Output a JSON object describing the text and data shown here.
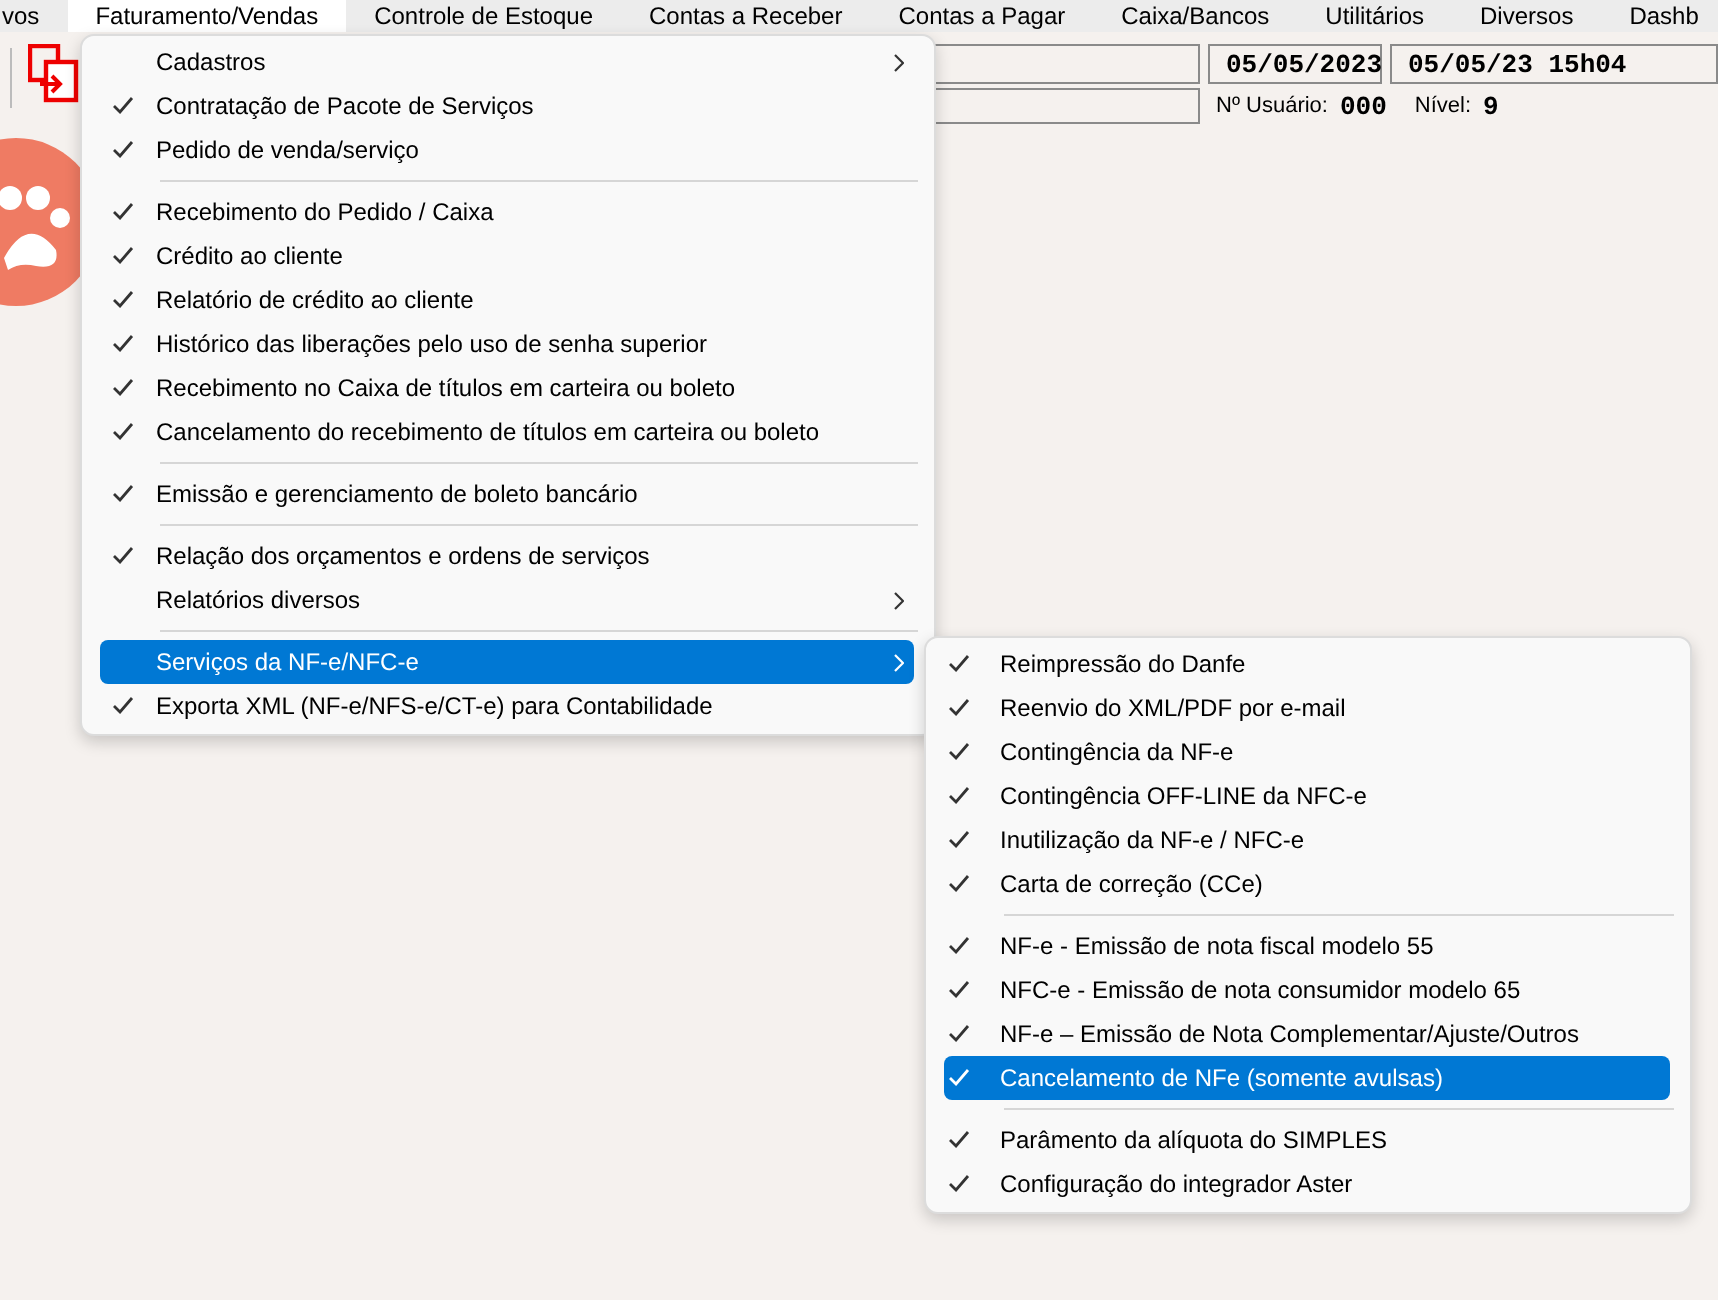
{
  "menubar": [
    {
      "label": "vos",
      "selected": false
    },
    {
      "label": "Faturamento/Vendas",
      "selected": true
    },
    {
      "label": "Controle de Estoque",
      "selected": false
    },
    {
      "label": "Contas a Receber",
      "selected": false
    },
    {
      "label": "Contas a Pagar",
      "selected": false
    },
    {
      "label": "Caixa/Bancos",
      "selected": false
    },
    {
      "label": "Utilitários",
      "selected": false
    },
    {
      "label": "Diversos",
      "selected": false
    },
    {
      "label": "Dashb",
      "selected": false
    }
  ],
  "status": {
    "date": "05/05/2023",
    "datetime": "05/05/23 15h04",
    "user_label": "Nº Usuário:",
    "user": "000",
    "level_label": "Nível:",
    "level_value": "9"
  },
  "menu": [
    {
      "kind": "item",
      "label": "Cadastros",
      "checked": false,
      "submenu": true,
      "selected": false
    },
    {
      "kind": "item",
      "label": "Contratação de Pacote de Serviços",
      "checked": true,
      "submenu": false,
      "selected": false
    },
    {
      "kind": "item",
      "label": "Pedido de venda/serviço",
      "checked": true,
      "submenu": false,
      "selected": false
    },
    {
      "kind": "separator"
    },
    {
      "kind": "item",
      "label": "Recebimento do Pedido / Caixa",
      "checked": true,
      "submenu": false,
      "selected": false
    },
    {
      "kind": "item",
      "label": "Crédito ao cliente",
      "checked": true,
      "submenu": false,
      "selected": false
    },
    {
      "kind": "item",
      "label": "Relatório de crédito ao cliente",
      "checked": true,
      "submenu": false,
      "selected": false
    },
    {
      "kind": "item",
      "label": "Histórico das liberações pelo uso de senha superior",
      "checked": true,
      "submenu": false,
      "selected": false
    },
    {
      "kind": "item",
      "label": "Recebimento no Caixa de títulos em carteira ou boleto",
      "checked": true,
      "submenu": false,
      "selected": false
    },
    {
      "kind": "item",
      "label": "Cancelamento do recebimento de títulos em carteira ou boleto",
      "checked": true,
      "submenu": false,
      "selected": false
    },
    {
      "kind": "separator"
    },
    {
      "kind": "item",
      "label": "Emissão e gerenciamento de boleto bancário",
      "checked": true,
      "submenu": false,
      "selected": false
    },
    {
      "kind": "separator"
    },
    {
      "kind": "item",
      "label": "Relação dos orçamentos e ordens de serviços",
      "checked": true,
      "submenu": false,
      "selected": false
    },
    {
      "kind": "item",
      "label": "Relatórios diversos",
      "checked": false,
      "submenu": true,
      "selected": false
    },
    {
      "kind": "separator"
    },
    {
      "kind": "item",
      "label": "Serviços da NF-e/NFC-e",
      "checked": false,
      "submenu": true,
      "selected": true
    },
    {
      "kind": "item",
      "label": "Exporta XML (NF-e/NFS-e/CT-e) para Contabilidade",
      "checked": true,
      "submenu": false,
      "selected": false
    }
  ],
  "submenu": [
    {
      "kind": "item",
      "label": "Reimpressão do Danfe",
      "checked": true,
      "submenu": false,
      "selected": false
    },
    {
      "kind": "item",
      "label": "Reenvio do XML/PDF por e-mail",
      "checked": true,
      "submenu": false,
      "selected": false
    },
    {
      "kind": "item",
      "label": "Contingência da NF-e",
      "checked": true,
      "submenu": false,
      "selected": false
    },
    {
      "kind": "item",
      "label": "Contingência OFF-LINE da NFC-e",
      "checked": true,
      "submenu": false,
      "selected": false
    },
    {
      "kind": "item",
      "label": "Inutilização da NF-e / NFC-e",
      "checked": true,
      "submenu": false,
      "selected": false
    },
    {
      "kind": "item",
      "label": "Carta de correção (CCe)",
      "checked": true,
      "submenu": false,
      "selected": false
    },
    {
      "kind": "separator"
    },
    {
      "kind": "item",
      "label": "NF-e - Emissão de nota fiscal modelo 55",
      "checked": true,
      "submenu": false,
      "selected": false
    },
    {
      "kind": "item",
      "label": "NFC-e - Emissão de nota consumidor modelo 65",
      "checked": true,
      "submenu": false,
      "selected": false
    },
    {
      "kind": "item",
      "label": "NF-e – Emissão de Nota Complementar/Ajuste/Outros",
      "checked": true,
      "submenu": false,
      "selected": false
    },
    {
      "kind": "item",
      "label": "Cancelamento de NFe (somente avulsas)",
      "checked": true,
      "submenu": false,
      "selected": true
    },
    {
      "kind": "separator"
    },
    {
      "kind": "item",
      "label": "Parâmento da alíquota do SIMPLES",
      "checked": true,
      "submenu": false,
      "selected": false
    },
    {
      "kind": "item",
      "label": "Configuração do integrador Aster",
      "checked": true,
      "submenu": false,
      "selected": false
    }
  ]
}
